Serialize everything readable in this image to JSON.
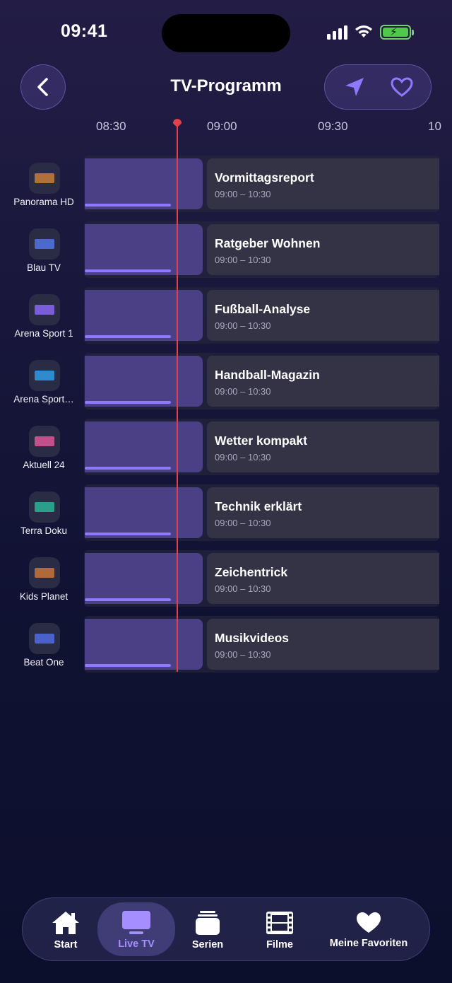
{
  "status_bar": {
    "time": "09:41"
  },
  "header": {
    "title": "TV-Programm"
  },
  "timeline": {
    "labels": [
      "08:30",
      "09:00",
      "09:30",
      "10"
    ]
  },
  "channels": [
    {
      "name": "Panorama HD",
      "logo_color": "#b0703a",
      "program": {
        "title": "Vormittagsreport",
        "time": "09:00 – 10:30"
      }
    },
    {
      "name": "Blau TV",
      "logo_color": "#4a6ad0",
      "program": {
        "title": "Ratgeber Wohnen",
        "time": "09:00 – 10:30"
      }
    },
    {
      "name": "Arena Sport 1",
      "logo_color": "#7a5ed8",
      "program": {
        "title": "Fußball-Analyse",
        "time": "09:00 – 10:30"
      }
    },
    {
      "name": "Arena Sport…",
      "logo_color": "#2f8ad0",
      "program": {
        "title": "Handball-Magazin",
        "time": "09:00 – 10:30"
      }
    },
    {
      "name": "Aktuell 24",
      "logo_color": "#c2508c",
      "program": {
        "title": "Wetter kompakt",
        "time": "09:00 – 10:30"
      }
    },
    {
      "name": "Terra Doku",
      "logo_color": "#2aa08a",
      "program": {
        "title": "Technik erklärt",
        "time": "09:00 – 10:30"
      }
    },
    {
      "name": "Kids Planet",
      "logo_color": "#b06a3a",
      "program": {
        "title": "Zeichentrick",
        "time": "09:00 – 10:30"
      }
    },
    {
      "name": "Beat One",
      "logo_color": "#4a62c8",
      "program": {
        "title": "Musikvideos",
        "time": "09:00 – 10:30"
      }
    }
  ],
  "tabbar": {
    "tabs": [
      {
        "label": "Start",
        "icon": "home-icon"
      },
      {
        "label": "Live TV",
        "icon": "tv-icon",
        "active": true
      },
      {
        "label": "Serien",
        "icon": "stack-icon"
      },
      {
        "label": "Filme",
        "icon": "film-icon"
      },
      {
        "label": "Meine Favoriten",
        "icon": "heart-icon"
      }
    ]
  },
  "colors": {
    "accent": "#8d78ff",
    "now_line": "#e2414b"
  }
}
